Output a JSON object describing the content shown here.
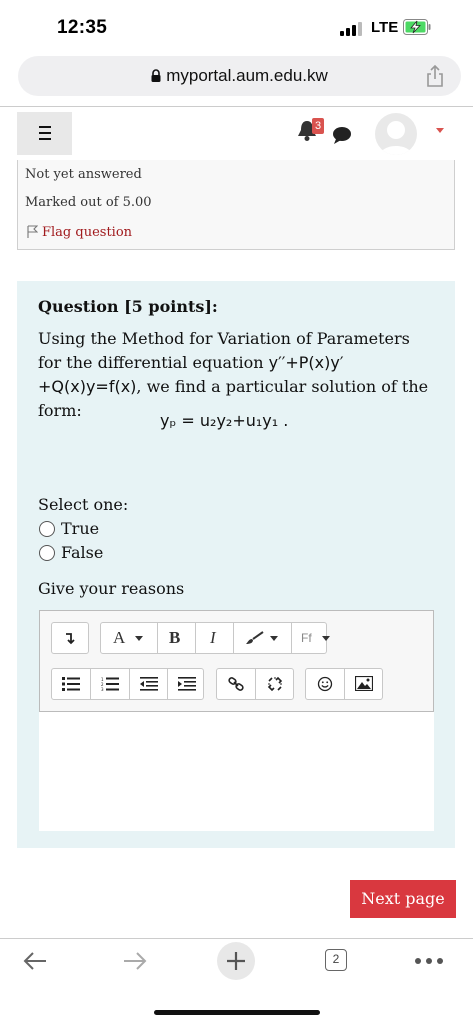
{
  "status_bar": {
    "time": "12:35",
    "network": "LTE"
  },
  "browser": {
    "url": "myportal.aum.edu.kw",
    "tabs_count": "2"
  },
  "header": {
    "notification_count": "3"
  },
  "question_info": {
    "state": "Not yet answered",
    "marks": "Marked out of 5.00",
    "flag_label": "Flag question"
  },
  "question": {
    "title": "Question [5 points]:",
    "text_before": "Using the Method for Variation of Parameters for the differential equation ",
    "equation": "y′′+P(x)y′+Q(x)y=f(x)",
    "text_after": ", we find a particular solution of the form:",
    "formula": "yₚ = u₂y₂+u₁y₁ .",
    "select_label": "Select one:",
    "options": [
      "True",
      "False"
    ],
    "reasons_label": "Give your reasons"
  },
  "editor": {
    "font_color_label": "A",
    "bold_label": "B",
    "italic_label": "I",
    "font_family_label": "Ff"
  },
  "navigation": {
    "next_label": "Next page"
  },
  "colors": {
    "accent": "#d9383f",
    "question_bg": "#e7f3f5"
  }
}
